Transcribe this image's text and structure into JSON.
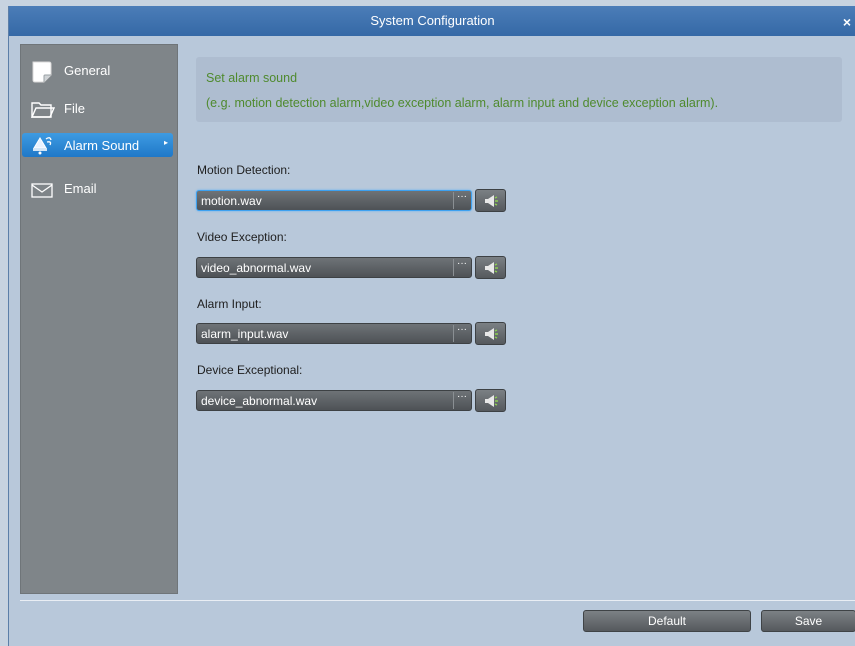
{
  "window": {
    "title": "System Configuration",
    "close_label": "×"
  },
  "sidebar": {
    "items": [
      {
        "label": "General",
        "icon": "document-icon",
        "active": false
      },
      {
        "label": "File",
        "icon": "folder-icon",
        "active": false
      },
      {
        "label": "Alarm Sound",
        "icon": "alarm-sound-icon",
        "active": true
      },
      {
        "label": "Email",
        "icon": "envelope-icon",
        "active": false
      }
    ]
  },
  "info": {
    "line1": "Set alarm sound",
    "line2": "(e.g. motion detection alarm,video exception alarm, alarm input and device exception alarm).",
    "color": "#4f8a2e"
  },
  "fields": [
    {
      "label": "Motion Detection:",
      "value": "motion.wav"
    },
    {
      "label": "Video Exception:",
      "value": "video_abnormal.wav"
    },
    {
      "label": "Alarm Input:",
      "value": "alarm_input.wav"
    },
    {
      "label": "Device Exceptional:",
      "value": "device_abnormal.wav"
    }
  ],
  "browse_label": "···",
  "footer": {
    "default_label": "Default",
    "save_label": "Save"
  },
  "colors": {
    "titlebar": "#3a6eaa",
    "active_nav": "#2b8ad6",
    "sidebar": "#7f8589"
  }
}
